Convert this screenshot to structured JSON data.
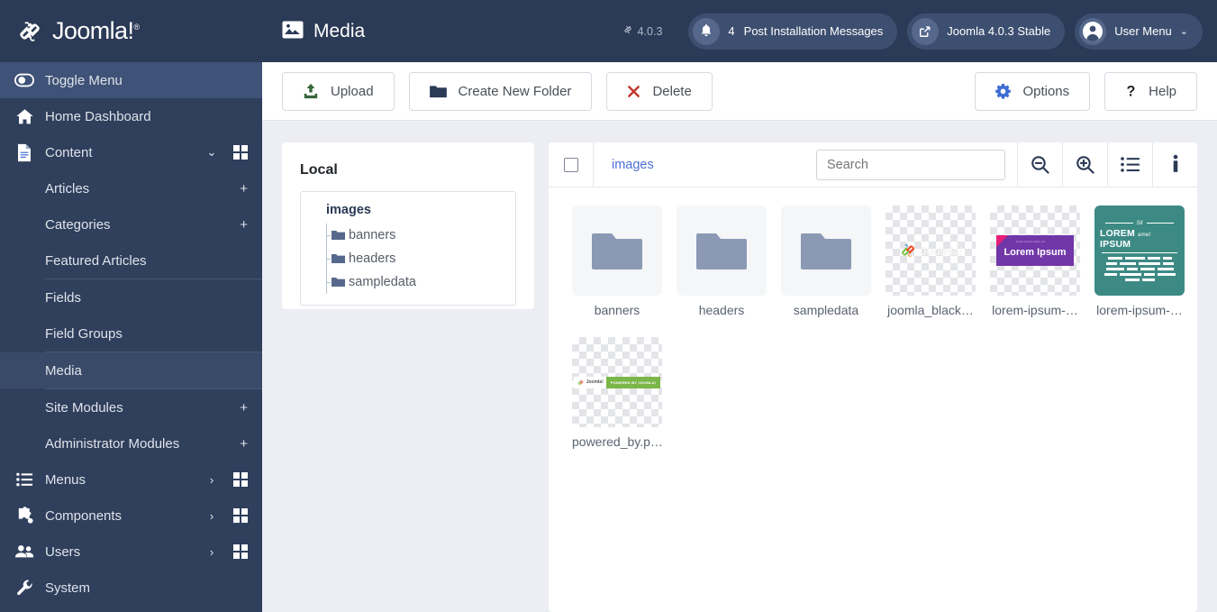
{
  "brand": {
    "name": "Joomla!",
    "logo_icon": "joomla-logo-icon"
  },
  "sidebar": {
    "toggle": {
      "label": "Toggle Menu",
      "icon": "toggle-menu-icon"
    },
    "items": [
      {
        "label": "Home Dashboard",
        "icon": "home-icon"
      },
      {
        "label": "Content",
        "icon": "document-icon",
        "chevron": "⌄",
        "grid": true
      }
    ],
    "content_children": [
      {
        "label": "Articles",
        "plus": "+"
      },
      {
        "label": "Categories",
        "plus": "+"
      },
      {
        "label": "Featured Articles"
      },
      {
        "sep": true
      },
      {
        "label": "Fields"
      },
      {
        "label": "Field Groups"
      },
      {
        "sep": true
      },
      {
        "label": "Media",
        "selected": true
      },
      {
        "sep": true
      },
      {
        "label": "Site Modules",
        "plus": "+"
      },
      {
        "label": "Administrator Modules",
        "plus": "+"
      }
    ],
    "bottom_items": [
      {
        "label": "Menus",
        "icon": "list-icon",
        "chevron": "›",
        "grid": true
      },
      {
        "label": "Components",
        "icon": "puzzle-icon",
        "chevron": "›",
        "grid": true
      },
      {
        "label": "Users",
        "icon": "users-icon",
        "chevron": "›",
        "grid": true
      },
      {
        "label": "System",
        "icon": "wrench-icon"
      }
    ]
  },
  "topbar": {
    "title": "Media",
    "title_icon": "image-icon",
    "version": "4.0.3",
    "version_icon": "joomla-mark-icon",
    "messages": {
      "count": "4",
      "label": "Post Installation Messages",
      "icon": "bell-icon"
    },
    "stable": {
      "label": "Joomla 4.0.3 Stable",
      "icon": "external-link-icon"
    },
    "user": {
      "label": "User Menu",
      "icon": "user-circle-icon",
      "caret": "⌄"
    }
  },
  "toolbar": {
    "upload": {
      "label": "Upload",
      "icon": "upload-icon",
      "color": "#37663d"
    },
    "create_folder": {
      "label": "Create New Folder",
      "icon": "folder-icon",
      "color": "#2b3a56"
    },
    "delete": {
      "label": "Delete",
      "icon": "close-x-icon",
      "color": "#c0392b"
    },
    "options": {
      "label": "Options",
      "icon": "gear-icon",
      "color": "#3e6dd4"
    },
    "help": {
      "label": "Help",
      "icon": "question-icon",
      "color": "#212529"
    }
  },
  "tree": {
    "title": "Local",
    "root": "images",
    "children": [
      {
        "label": "banners",
        "icon": "folder-icon"
      },
      {
        "label": "headers",
        "icon": "folder-icon"
      },
      {
        "label": "sampledata",
        "icon": "folder-icon"
      }
    ]
  },
  "browser": {
    "select_all_checkbox": "select-all-checkbox",
    "breadcrumb": "images",
    "search": {
      "placeholder": "Search",
      "value": ""
    },
    "actions": [
      {
        "name": "zoom-out-icon"
      },
      {
        "name": "zoom-in-icon"
      },
      {
        "name": "list-view-icon"
      },
      {
        "name": "info-icon"
      }
    ],
    "items": [
      {
        "label": "banners",
        "kind": "folder"
      },
      {
        "label": "headers",
        "kind": "folder"
      },
      {
        "label": "sampledata",
        "kind": "folder"
      },
      {
        "label": "joomla_black…",
        "kind": "joomla-logo"
      },
      {
        "label": "lorem-ipsum-…",
        "kind": "lorem-banner"
      },
      {
        "label": "lorem-ipsum-…",
        "kind": "teal-card"
      },
      {
        "label": "powered_by.p…",
        "kind": "powered-by"
      }
    ],
    "art": {
      "lorem_banner_small": "lorem ipsum dolor sit",
      "lorem_banner_title": "Lorem Ipsum",
      "teal_sit": "Sit",
      "teal_lorem": "LOREM",
      "teal_amet": "amet",
      "teal_ipsum": "IPSUM",
      "powered_logo_text": "Joomla!",
      "powered_badge_text": "POWERED BY JOOMLA!",
      "joomla_wordmark": "Joomla!"
    }
  },
  "colors": {
    "sidebar_bg": "#2f3f5c",
    "topbar_bg": "#2b3a56",
    "accent_blue": "#4a6fd4",
    "page_bg": "#eceef3",
    "teal": "#3d8a84",
    "purple": "#7136a8",
    "magenta": "#e91e78",
    "green": "#7ab648"
  }
}
